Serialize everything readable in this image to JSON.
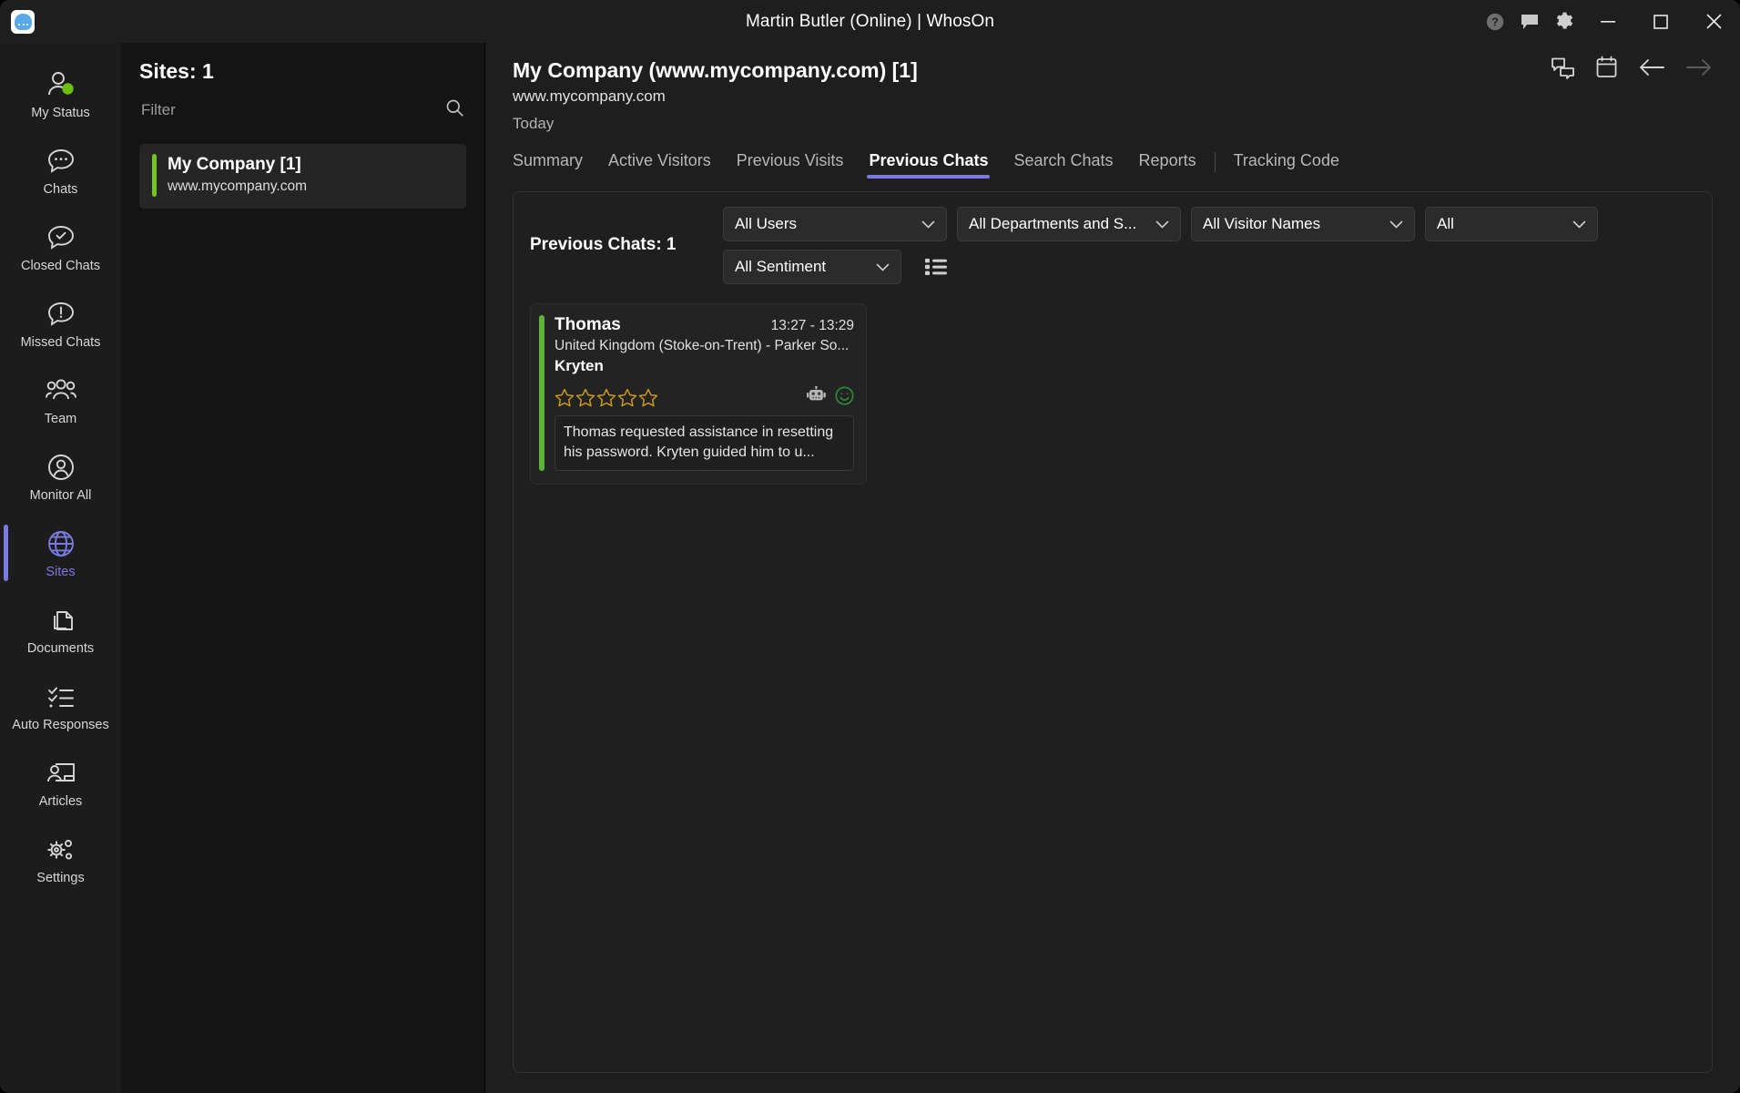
{
  "titlebar": {
    "app_logo": "whoson-logo-icon",
    "title": "Martin Butler (Online)  | WhosOn",
    "help_icon": "help-icon",
    "feedback_icon": "feedback-icon",
    "settings_icon": "gear-icon",
    "minimize": "minimize-icon",
    "maximize": "maximize-icon",
    "close": "close-icon"
  },
  "nav": {
    "items": [
      {
        "label": "My Status",
        "icon": "person-status-icon",
        "active": false
      },
      {
        "label": "Chats",
        "icon": "chat-bubble-icon",
        "active": false
      },
      {
        "label": "Closed Chats",
        "icon": "chat-check-icon",
        "active": false
      },
      {
        "label": "Missed Chats",
        "icon": "chat-alert-icon",
        "active": false
      },
      {
        "label": "Team",
        "icon": "people-group-icon",
        "active": false
      },
      {
        "label": "Monitor All",
        "icon": "person-circle-icon",
        "active": false
      },
      {
        "label": "Sites",
        "icon": "globe-icon",
        "active": true
      },
      {
        "label": "Documents",
        "icon": "documents-icon",
        "active": false
      },
      {
        "label": "Auto Responses",
        "icon": "checklist-icon",
        "active": false
      },
      {
        "label": "Articles",
        "icon": "presentation-icon",
        "active": false
      },
      {
        "label": "Settings",
        "icon": "gears-icon",
        "active": false
      }
    ],
    "accent": "#7b7ae0",
    "status_dot": "#6bbf12"
  },
  "sites": {
    "header": "Sites: 1",
    "filter_placeholder": "Filter",
    "filter_value": "",
    "search_icon": "search-icon",
    "list": [
      {
        "name": "My Company [1]",
        "url": "www.mycompany.com",
        "status_color": "#74c322"
      }
    ]
  },
  "content": {
    "title": "My Company (www.mycompany.com) [1]",
    "subtitle": "www.mycompany.com",
    "period": "Today",
    "actions": [
      {
        "icon": "chats-overlap-icon",
        "disabled": false
      },
      {
        "icon": "calendar-icon",
        "disabled": false
      },
      {
        "icon": "arrow-left-icon",
        "disabled": false
      },
      {
        "icon": "arrow-right-icon",
        "disabled": true
      }
    ],
    "tabs": [
      {
        "label": "Summary",
        "active": false,
        "sep_before": false
      },
      {
        "label": "Active Visitors",
        "active": false,
        "sep_before": false
      },
      {
        "label": "Previous Visits",
        "active": false,
        "sep_before": false
      },
      {
        "label": "Previous Chats",
        "active": true,
        "sep_before": false
      },
      {
        "label": "Search Chats",
        "active": false,
        "sep_before": false
      },
      {
        "label": "Reports",
        "active": false,
        "sep_before": false
      },
      {
        "label": "Tracking Code",
        "active": false,
        "sep_before": true
      }
    ],
    "accent": "#7b7ae0"
  },
  "panel": {
    "count_label": "Previous Chats: 1",
    "filters": {
      "users": "All Users",
      "departments": "All Departments and S...",
      "visitor_names": "All Visitor Names",
      "all": "All",
      "sentiment": "All  Sentiment",
      "list_view_icon": "list-view-icon",
      "chevron_icon": "chevron-down-icon"
    },
    "chats": [
      {
        "visitor": "Thomas",
        "time": "13:27 - 13:29",
        "location": "United Kingdom (Stoke-on-Trent) - Parker So...",
        "operator": "Kryten",
        "rating": 0,
        "rating_max": 5,
        "star_color": "#c9991f",
        "bot_icon": "robot-icon",
        "sentiment_icon": "smiley-positive-icon",
        "sentiment_color": "#2e8b36",
        "summary": "Thomas requested assistance in resetting his password. Kryten guided him to u...",
        "status_color": "#5cb338"
      }
    ]
  }
}
